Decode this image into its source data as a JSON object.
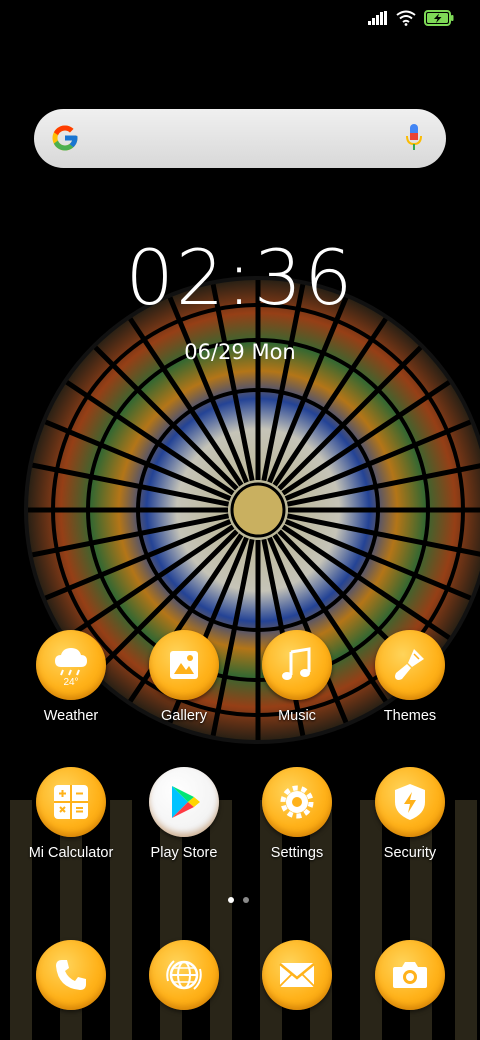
{
  "status_bar": {
    "signal_icon": "signal-icon",
    "wifi_icon": "wifi-icon",
    "battery_icon": "battery-charging-icon",
    "battery_color": "#7ed957"
  },
  "search": {
    "logo_icon": "google-logo-icon",
    "mic_icon": "mic-icon"
  },
  "clock": {
    "time": "02:36",
    "date": "06/29 Mon"
  },
  "apps_row1": [
    {
      "label": "Weather",
      "icon": "weather-icon",
      "temp": "24°"
    },
    {
      "label": "Gallery",
      "icon": "gallery-icon"
    },
    {
      "label": "Music",
      "icon": "music-icon"
    },
    {
      "label": "Themes",
      "icon": "themes-brush-icon"
    }
  ],
  "apps_row2": [
    {
      "label": "Mi Calculator",
      "icon": "calculator-icon"
    },
    {
      "label": "Play Store",
      "icon": "play-store-icon"
    },
    {
      "label": "Settings",
      "icon": "settings-gear-icon"
    },
    {
      "label": "Security",
      "icon": "security-shield-icon"
    }
  ],
  "dock": [
    {
      "icon": "phone-icon"
    },
    {
      "icon": "browser-globe-icon"
    },
    {
      "icon": "messages-icon"
    },
    {
      "icon": "camera-icon"
    }
  ],
  "page_indicator": {
    "pages": 2,
    "active": 1
  },
  "colors": {
    "icon_orange": "#ffb21a",
    "glyph": "#ffffff"
  }
}
